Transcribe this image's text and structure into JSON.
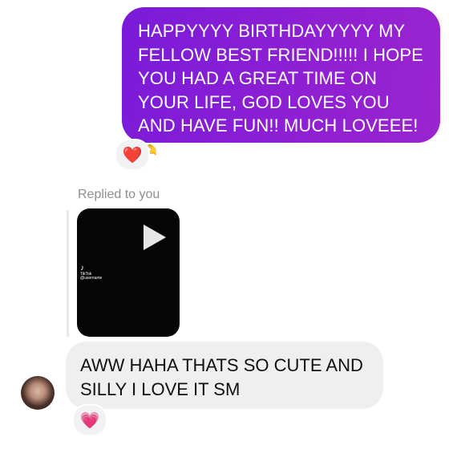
{
  "sent_message": {
    "text": "HAPPYYYY BIRTHDAYYYYY MY FELLOW BEST FRIEND!!!!! I HOPE YOU HAD A GREAT TIME ON YOUR LIFE, GOD LOVES YOU AND HAVE FUN!! MUCH LOVEEE!",
    "emoji": "🫶",
    "reaction": "❤️"
  },
  "reply_context": {
    "label": "Replied to you",
    "video_watermark": "TikTok",
    "video_handle": "@username"
  },
  "received_message": {
    "text": "AWW HAHA THATS SO CUTE AND SILLY I LOVE IT SM",
    "reaction": "💗"
  },
  "colors": {
    "sent_bubble_start": "#7a1bd9",
    "sent_bubble_end": "#9a24cf",
    "received_bubble": "#efeff0",
    "video_background": "#050505"
  },
  "icons": {
    "play": "play-icon",
    "tiktok": "tiktok-logo-icon"
  }
}
